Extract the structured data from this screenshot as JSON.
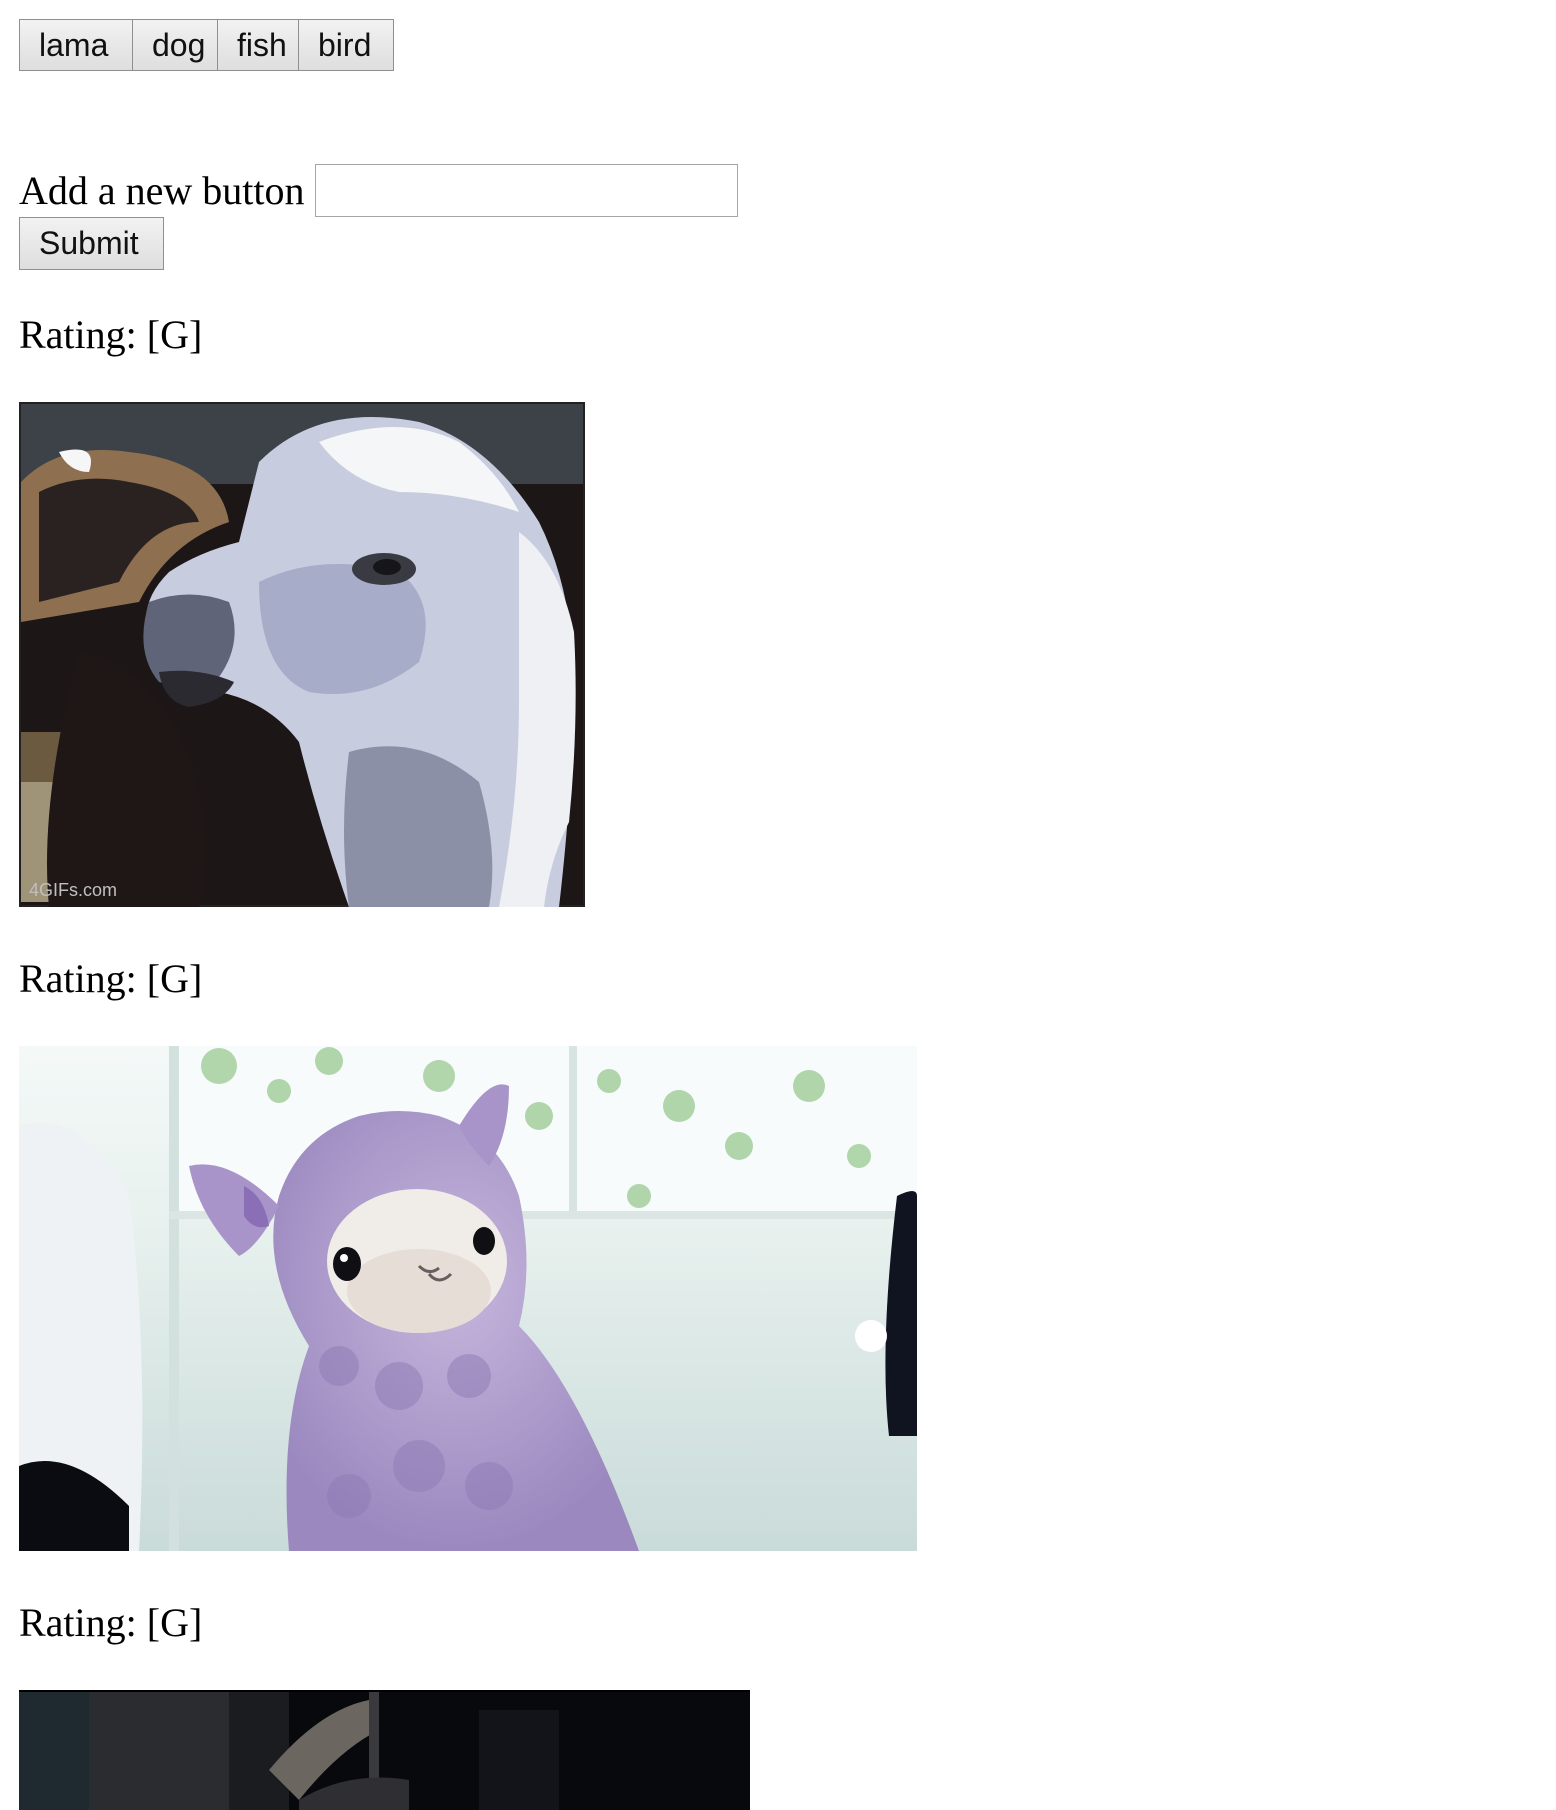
{
  "topics": {
    "buttons": [
      {
        "label": "lama"
      },
      {
        "label": "dog"
      },
      {
        "label": "fish"
      },
      {
        "label": "bird"
      }
    ]
  },
  "form": {
    "label": "Add a new button",
    "input_value": "",
    "submit_label": "Submit"
  },
  "results": [
    {
      "rating": "Rating: [G]",
      "image_subject": "llama close-up",
      "watermark": "4GIFs.com"
    },
    {
      "rating": "Rating: [G]",
      "image_subject": "purple plush alpaca"
    },
    {
      "rating": "Rating: [G]",
      "image_subject": "dark scene (partially visible)"
    }
  ]
}
